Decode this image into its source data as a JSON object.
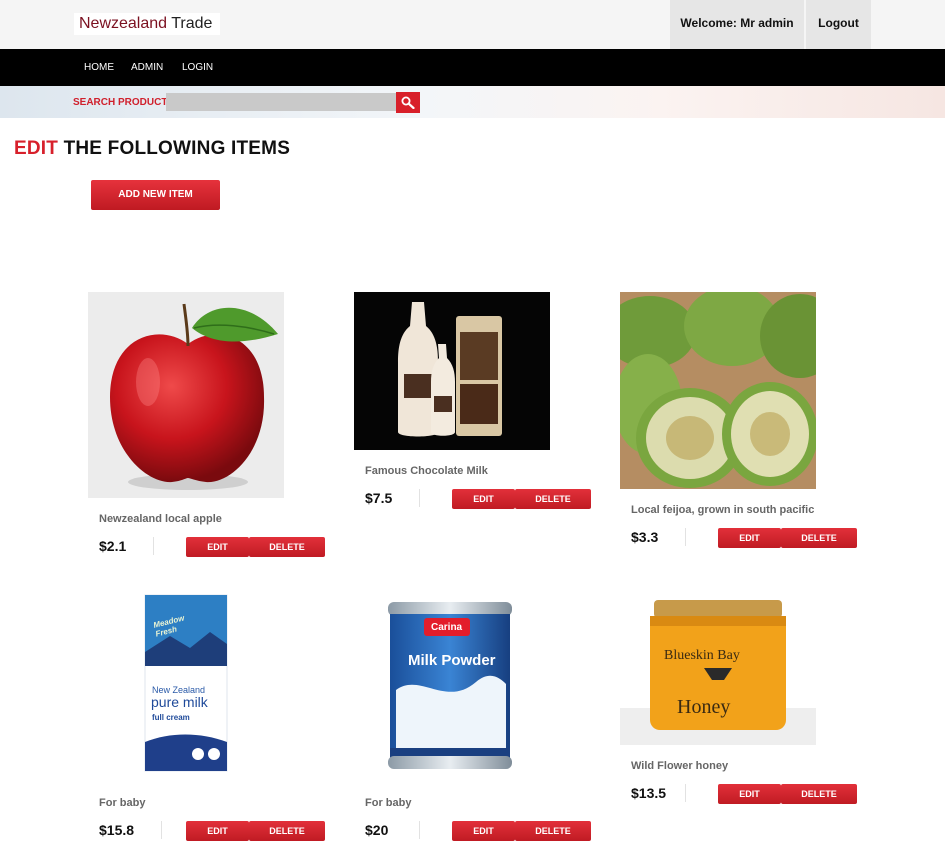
{
  "header": {
    "logo_part1": "Newzealand",
    "logo_part2": "Trade",
    "welcome": "Welcome: Mr admin",
    "logout": "Logout"
  },
  "nav": {
    "items": [
      "HOME",
      "ADMIN",
      "LOGIN"
    ]
  },
  "search": {
    "label": "SEARCH PRODUCT",
    "value": ""
  },
  "page": {
    "heading_red": "EDIT",
    "heading_rest": "THE FOLLOWING ITEMS",
    "add_button": "ADD NEW ITEM"
  },
  "products": [
    {
      "name": "Newzealand local apple",
      "price": "$2.1",
      "edit": "EDIT",
      "delete": "DELETE",
      "icon": "apple-image"
    },
    {
      "name": "Famous Chocolate Milk",
      "price": "$7.5",
      "edit": "EDIT",
      "delete": "DELETE",
      "icon": "chocolate-milk-image"
    },
    {
      "name": "Local feijoa, grown in south pacific",
      "price": "$3.3",
      "edit": "EDIT",
      "delete": "DELETE",
      "icon": "feijoa-image"
    },
    {
      "name": "For baby",
      "price": "$15.8",
      "edit": "EDIT",
      "delete": "DELETE",
      "icon": "milk-carton-image",
      "carton_brand": "Meadow Fresh",
      "carton_line1": "New Zealand",
      "carton_line2": "pure milk",
      "carton_line3": "full cream"
    },
    {
      "name": "For baby",
      "price": "$20",
      "edit": "EDIT",
      "delete": "DELETE",
      "icon": "milk-powder-tin-image",
      "tin_brand": "Carina",
      "tin_label": "Milk Powder"
    },
    {
      "name": "Wild Flower honey",
      "price": "$13.5",
      "edit": "EDIT",
      "delete": "DELETE",
      "icon": "honey-jar-image",
      "jar_line1": "Blueskin Bay",
      "jar_line2": "Honey"
    }
  ],
  "colors": {
    "accent": "#d7202b",
    "nav_bg": "#000000",
    "topbar_bg": "#f5f5f5"
  }
}
